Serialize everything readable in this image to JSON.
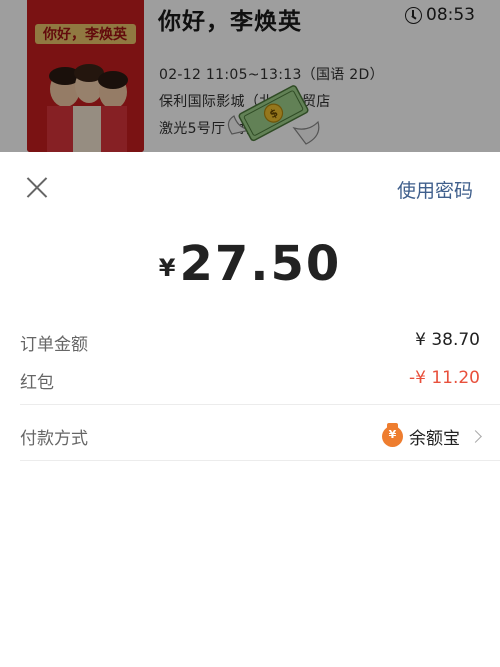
{
  "movie": {
    "title": "你好，李焕英",
    "countdown": "08:53",
    "showtime": "02-12 11:05~13:13（国语 2D）",
    "cinema": "保利国际影城（北京华贸店",
    "hall": "激光5号厅 5排",
    "poster_title": "你好，李焕英"
  },
  "sheet": {
    "use_password_label": "使用密码",
    "currency_symbol": "¥",
    "amount": "27.50",
    "order_amount_label": "订单金额",
    "order_amount_value": "¥ 38.70",
    "red_packet_label": "红包",
    "red_packet_value": "-¥ 11.20",
    "payment_method_label": "付款方式",
    "payment_method_value": "余额宝"
  },
  "icons": {
    "close": "close-icon",
    "clock": "clock-icon",
    "money_bag": "money-bag-icon",
    "chevron": "chevron-right-icon",
    "flying_money": "money-with-wings-icon"
  },
  "colors": {
    "link": "#3f5f8c",
    "discount": "#e8503c",
    "yuebao": "#ee7d2f",
    "overlay": "rgba(0,0,0,0.38)"
  }
}
